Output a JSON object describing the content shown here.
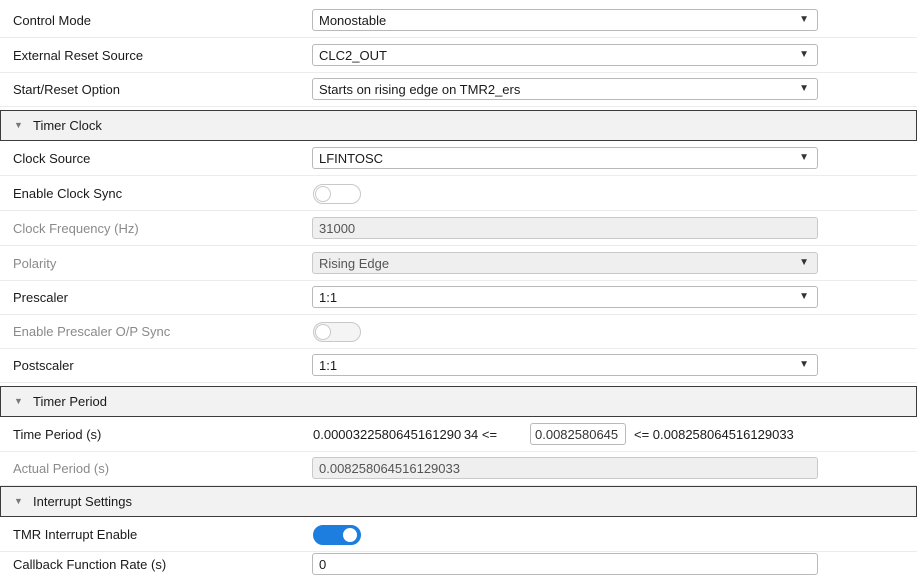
{
  "fields": {
    "control_mode": {
      "label": "Control Mode",
      "value": "Monostable"
    },
    "external_reset_source": {
      "label": "External Reset Source",
      "value": "CLC2_OUT"
    },
    "start_reset_option": {
      "label": "Start/Reset Option",
      "value": "Starts on rising edge on TMR2_ers"
    }
  },
  "timer_clock": {
    "title": "Timer Clock",
    "clock_source": {
      "label": "Clock Source",
      "value": "LFINTOSC"
    },
    "enable_clock_sync": {
      "label": "Enable Clock Sync",
      "enabled": false
    },
    "clock_frequency": {
      "label": "Clock Frequency (Hz)",
      "value": "31000"
    },
    "polarity": {
      "label": "Polarity",
      "value": "Rising Edge"
    },
    "prescaler": {
      "label": "Prescaler",
      "value": "1:1"
    },
    "enable_prescaler_sync": {
      "label": "Enable Prescaler O/P Sync",
      "enabled": false
    },
    "postscaler": {
      "label": "Postscaler",
      "value": "1:1"
    }
  },
  "timer_period": {
    "title": "Timer Period",
    "time_period": {
      "label": "Time Period (s)",
      "min_text": "0.0000322580645161290 34 <=",
      "input_value": "0.0082580645",
      "max_text": "<= 0.008258064516129033"
    },
    "actual_period": {
      "label": "Actual Period (s)",
      "value": "0.008258064516129033"
    }
  },
  "interrupt_settings": {
    "title": "Interrupt Settings",
    "tmr_interrupt_enable": {
      "label": "TMR Interrupt Enable",
      "enabled": true
    },
    "callback_rate": {
      "label": "Callback Function Rate (s)",
      "value": "0"
    }
  },
  "icons": {
    "dropdown_arrow": "▼",
    "collapse_triangle": "▼"
  }
}
